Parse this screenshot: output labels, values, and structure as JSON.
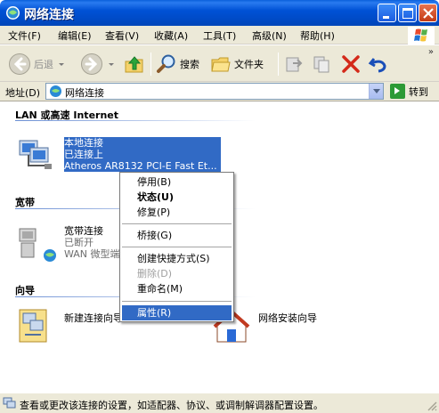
{
  "window": {
    "title": "网络连接",
    "icon": "network-connections-icon"
  },
  "menubar": {
    "items": [
      "文件(F)",
      "编辑(E)",
      "查看(V)",
      "收藏(A)",
      "工具(T)",
      "高级(N)",
      "帮助(H)"
    ]
  },
  "toolbar": {
    "back_label": "后退",
    "search_label": "搜索",
    "folders_label": "文件夹"
  },
  "address": {
    "label": "地址(D)",
    "value": "网络连接",
    "go_label": "转到"
  },
  "groups": [
    {
      "header": "LAN 或高速 Internet"
    },
    {
      "header": "宽带"
    },
    {
      "header": "向导"
    }
  ],
  "connections": {
    "lan": {
      "name": "本地连接",
      "status": "已连接上",
      "device": "Atheros AR8132 PCI-E Fast Et..."
    },
    "broadband": {
      "name": "宽带连接",
      "status": "已断开",
      "device": "WAN 微型端"
    },
    "wizard_new": {
      "name": "新建连接向导"
    },
    "wizard_network": {
      "name": "网络安装向导"
    }
  },
  "context_menu": {
    "items": [
      {
        "label": "停用(B)"
      },
      {
        "label": "状态(U)",
        "bold": true
      },
      {
        "label": "修复(P)"
      },
      {
        "label": "桥接(G)"
      },
      {
        "label": "创建快捷方式(S)"
      },
      {
        "label": "删除(D)",
        "disabled": true
      },
      {
        "label": "重命名(M)"
      },
      {
        "label": "属性(R)",
        "highlighted": true
      }
    ]
  },
  "status": {
    "text": "查看或更改该连接的设置，如适配器、协议、或调制解调器配置设置。"
  },
  "colors": {
    "titlebar": "#0052d6",
    "selection": "#316ac5",
    "chrome": "#ece9d8"
  }
}
